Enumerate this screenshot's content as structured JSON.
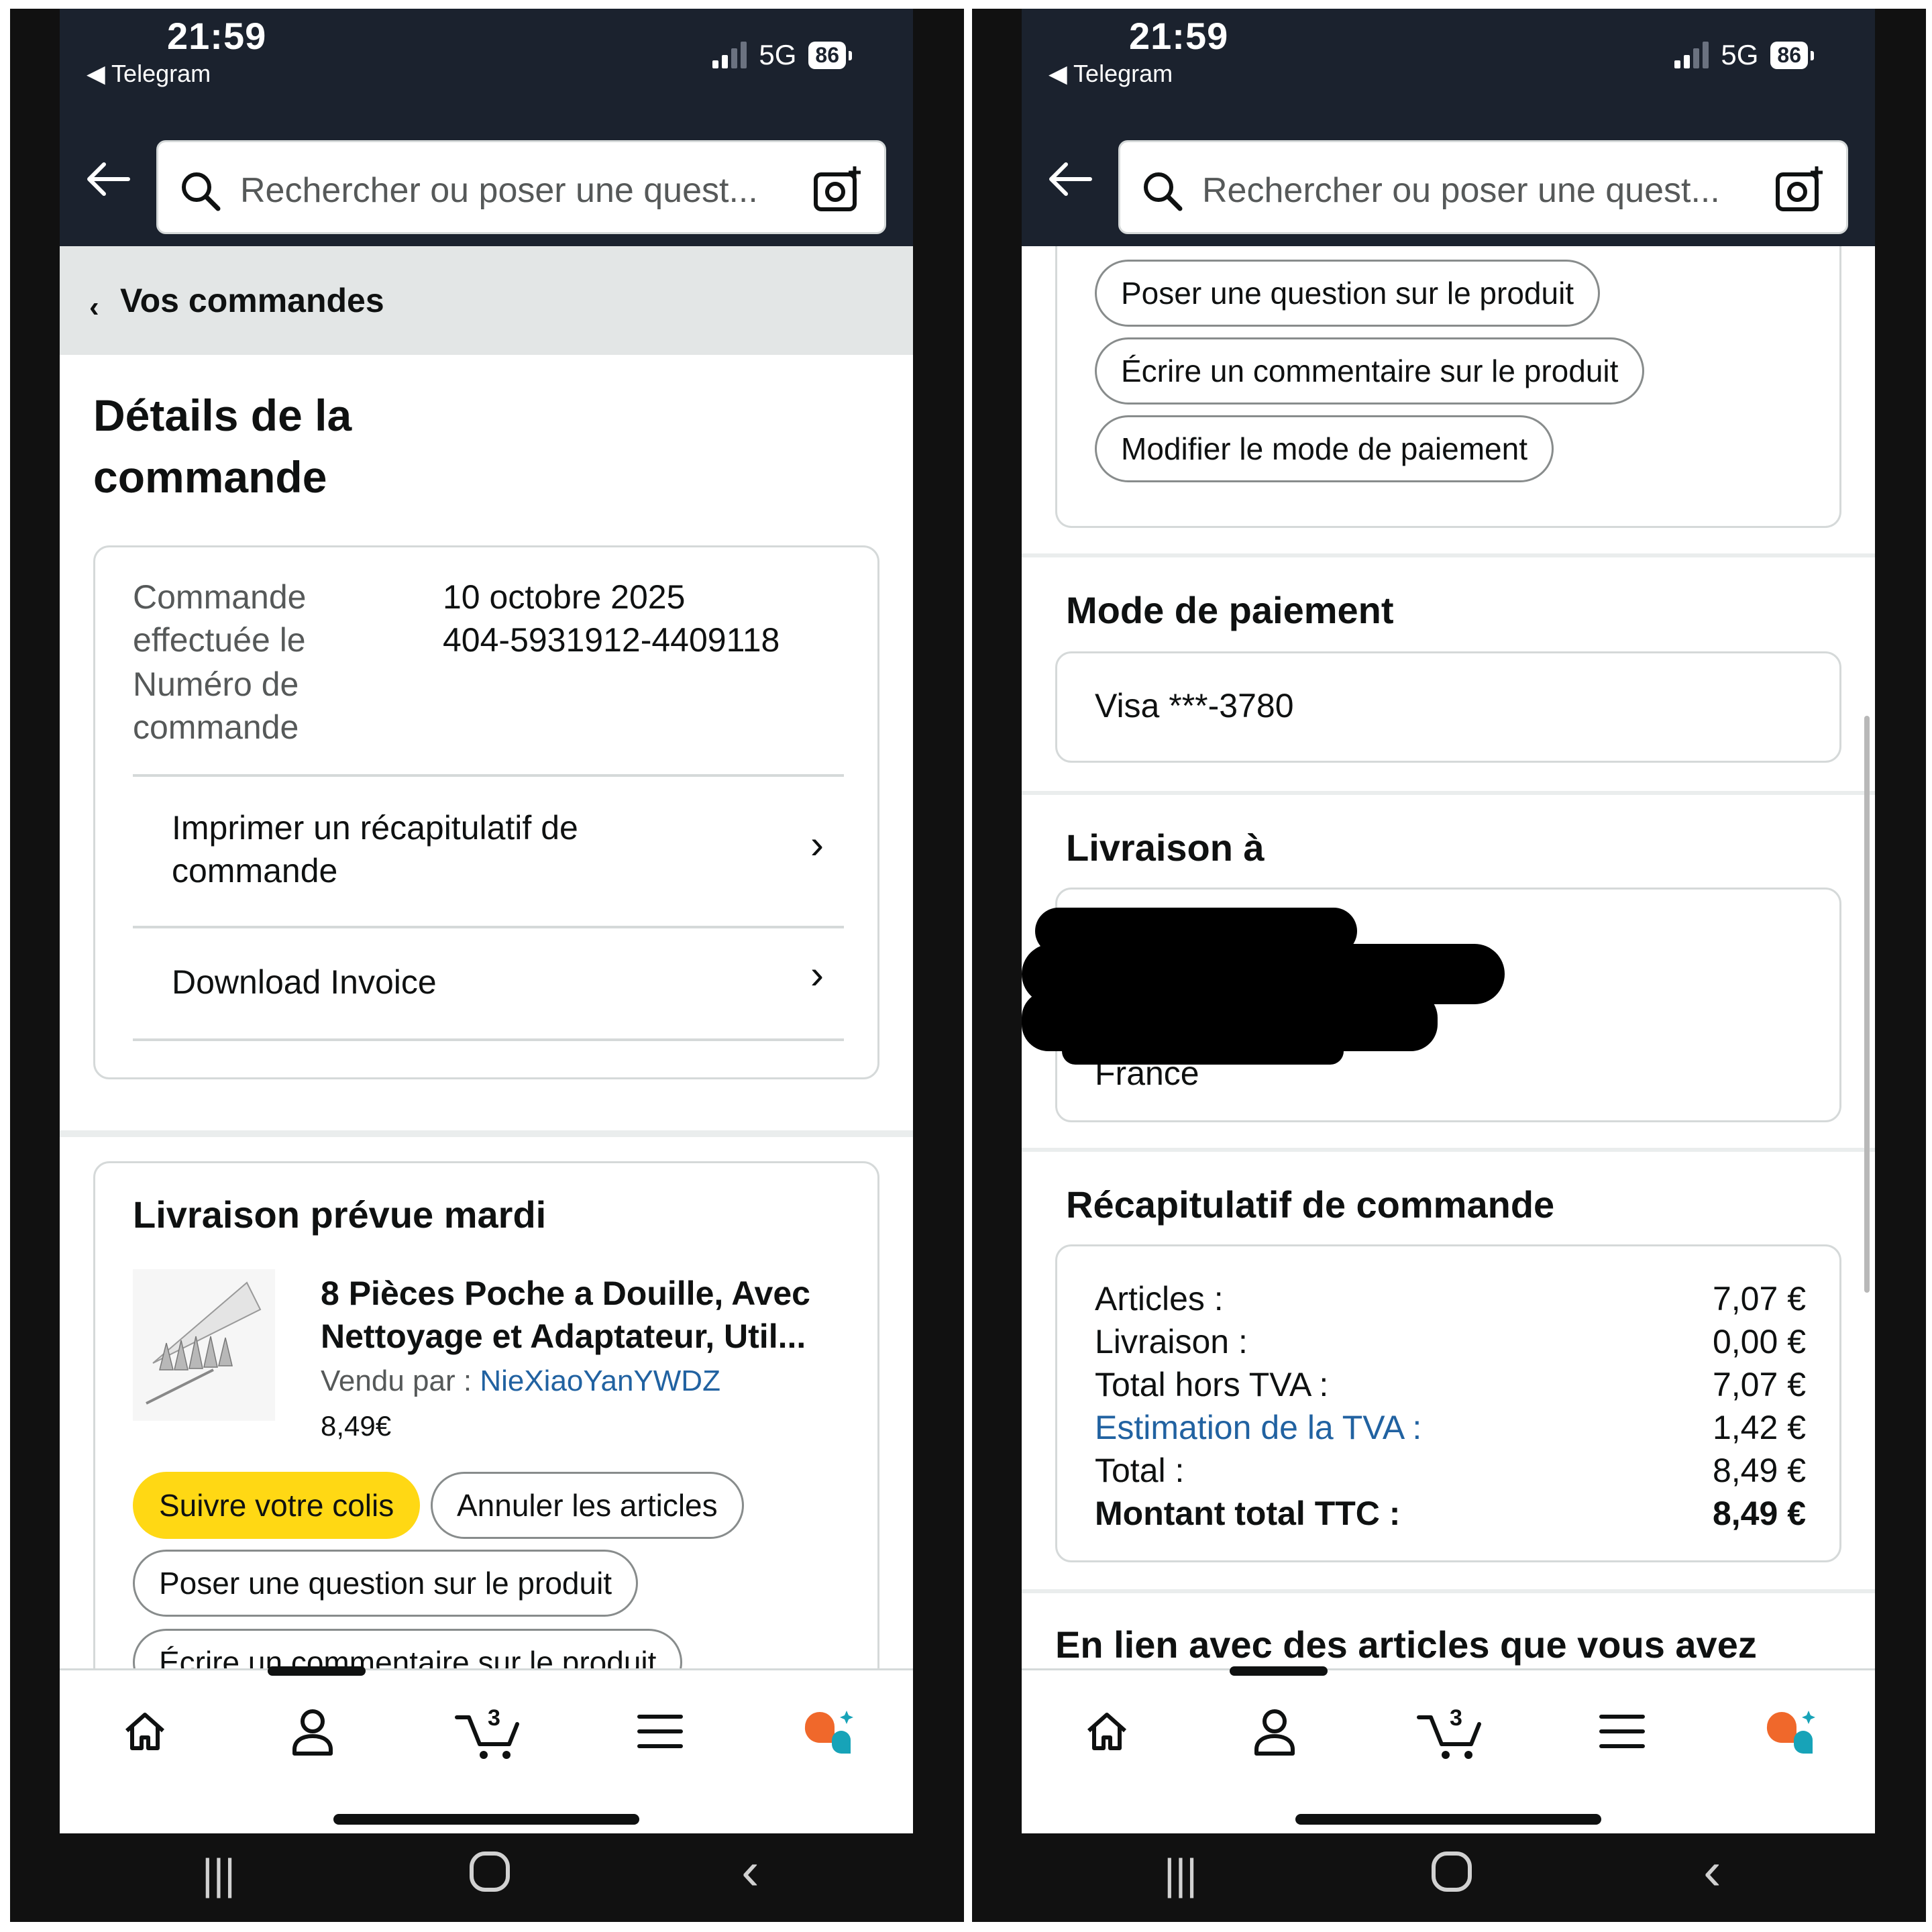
{
  "status": {
    "time": "21:59",
    "back_app": "Telegram",
    "network": "5G",
    "battery": "86"
  },
  "search": {
    "placeholder": "Rechercher ou poser une quest..."
  },
  "breadcrumb": {
    "label": "Vos commandes"
  },
  "page_title": "Détails de la commande",
  "order_info": {
    "date_label": "Commande effectuée le",
    "date_value": "10 octobre 2025",
    "number_label": "Numéro de commande",
    "number_value": "404-5931912-4409118",
    "print_summary": "Imprimer un récapitulatif de commande",
    "download_invoice": "Download Invoice"
  },
  "delivery": {
    "heading": "Livraison prévue mardi",
    "product_title": "8 Pièces Poche a Douille, Avec Nettoyage et Adaptateur, Util...",
    "seller_label": "Vendu par",
    "seller_sep": " : ",
    "seller_name": "NieXiaoYanYWDZ",
    "price": "8,49€",
    "buttons": {
      "track": "Suivre votre colis",
      "cancel": "Annuler les articles",
      "ask": "Poser une question sur le produit",
      "review": "Écrire un commentaire sur le produit",
      "payment_change": "Modifier le mode de paiement"
    }
  },
  "payment": {
    "heading": "Mode de paiement",
    "card": "Visa ***-3780"
  },
  "shipping": {
    "heading": "Livraison à",
    "country": "France"
  },
  "summary": {
    "heading": "Récapitulatif de commande",
    "rows": [
      {
        "label": "Articles :",
        "value": "7,07 €"
      },
      {
        "label": "Livraison :",
        "value": "0,00 €"
      },
      {
        "label": "Total hors TVA :",
        "value": "7,07 €"
      },
      {
        "label": "Estimation de la TVA :",
        "value": "1,42 €"
      },
      {
        "label": "Total :",
        "value": "8,49 €"
      },
      {
        "label": "Montant total TTC :",
        "value": "8,49 €"
      }
    ]
  },
  "related_heading": "En lien avec des articles que vous avez",
  "nav": {
    "cart_count": "3"
  },
  "colors": {
    "header": "#1b222e",
    "accent_yellow": "#ffd814",
    "link_blue": "#2162a1"
  }
}
